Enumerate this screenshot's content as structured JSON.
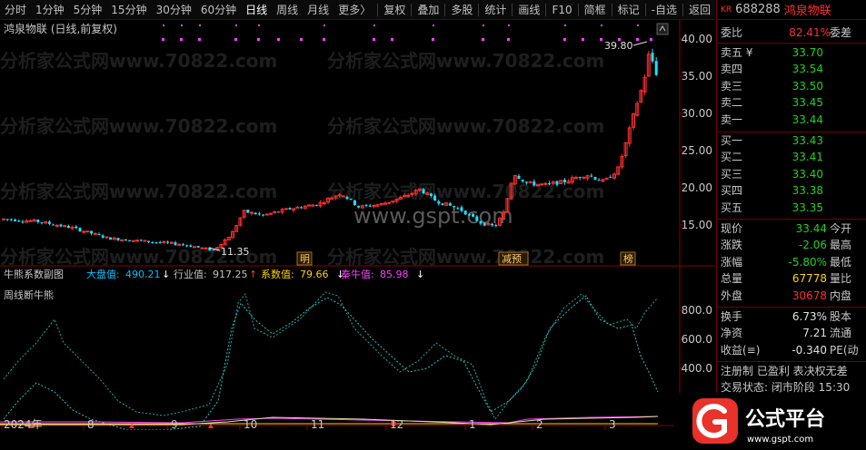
{
  "toolbar": {
    "items": [
      "分时",
      "1分钟",
      "5分钟",
      "15分钟",
      "30分钟",
      "60分钟",
      "日线",
      "周线",
      "月线",
      "更多〉"
    ],
    "right_items": [
      "复权",
      "叠加",
      "多股",
      "统计",
      "画线",
      "F10",
      "简框",
      "标记",
      "-自选",
      "返回"
    ],
    "active": "日线"
  },
  "main_chart": {
    "title": "鸿泉物联 (日线,前复权)",
    "y_ticks": [
      "40.00",
      "35.00",
      "30.00",
      "25.00",
      "20.00",
      "15.00"
    ],
    "high_label": "39.80",
    "low_label": "11.35",
    "event_labels": [
      "明",
      "减预",
      "榜"
    ],
    "watermark_domain": "www.gspt.com",
    "watermark_rows": [
      "分析家公式网www.70822.com",
      "分析家公式网www.70822.com",
      "分析家公式网www.70822.com",
      "分析家公式网www.70822.com"
    ]
  },
  "indicator": {
    "name": "牛熊系数副图",
    "items": [
      {
        "label": "大盘值:",
        "value": "490.21",
        "arrow": "↓",
        "color": "#00c0ff"
      },
      {
        "label": "行业值:",
        "value": "917.25",
        "arrow": "↑",
        "color": "#c0c0c0"
      },
      {
        "label": "系数值:",
        "value": "79.66",
        "arrow": "↓",
        "color": "#ffd000"
      },
      {
        "label": "秦牛值:",
        "value": "85.98",
        "arrow": "↓",
        "color": "#ff40ff"
      }
    ],
    "subtitle": "周线断牛熊",
    "y_ticks": [
      "800.0",
      "600.0",
      "400.0"
    ]
  },
  "x_axis": [
    "2024年",
    "8",
    "9",
    "10",
    "11",
    "12",
    "1",
    "2",
    "3"
  ],
  "quote": {
    "kr": "KR",
    "code": "688288",
    "name": "鸿泉物联",
    "wb_label": "委比",
    "wb_value": "82.41%",
    "wc_label": "委差",
    "sells": [
      {
        "label": "卖五 ¥",
        "price": "33.70"
      },
      {
        "label": "卖四",
        "price": "33.54"
      },
      {
        "label": "卖三",
        "price": "33.50"
      },
      {
        "label": "卖二",
        "price": "33.45"
      },
      {
        "label": "卖一",
        "price": "33.44"
      }
    ],
    "buys": [
      {
        "label": "买一",
        "price": "33.43"
      },
      {
        "label": "买二",
        "price": "33.41"
      },
      {
        "label": "买三",
        "price": "33.40"
      },
      {
        "label": "买四",
        "price": "33.38"
      },
      {
        "label": "买五",
        "price": "33.35"
      }
    ],
    "stats": [
      {
        "label": "现价",
        "value": "33.44",
        "color": "green",
        "label2": "今开"
      },
      {
        "label": "涨跌",
        "value": "-2.06",
        "color": "green",
        "label2": "最高"
      },
      {
        "label": "涨幅",
        "value": "-5.80%",
        "color": "green",
        "label2": "最低"
      },
      {
        "label": "总量",
        "value": "67778",
        "color": "yellow",
        "label2": "量比"
      },
      {
        "label": "外盘",
        "value": "30678",
        "color": "red",
        "label2": "内盘"
      }
    ],
    "stats2": [
      {
        "label": "换手",
        "value": "6.73%",
        "color": "white",
        "label2": "股本"
      },
      {
        "label": "净资",
        "value": "7.21",
        "color": "white",
        "label2": "流通"
      },
      {
        "label": "收益(≡)",
        "value": "-0.340",
        "color": "white",
        "label2": "PE(动"
      }
    ],
    "footer1": "注册制  已盈利  表决权无差",
    "footer2": "交易状态: 闭市阶段 15:30"
  },
  "logo": {
    "text": "公式平台",
    "domain": "www.gspt.com"
  }
}
